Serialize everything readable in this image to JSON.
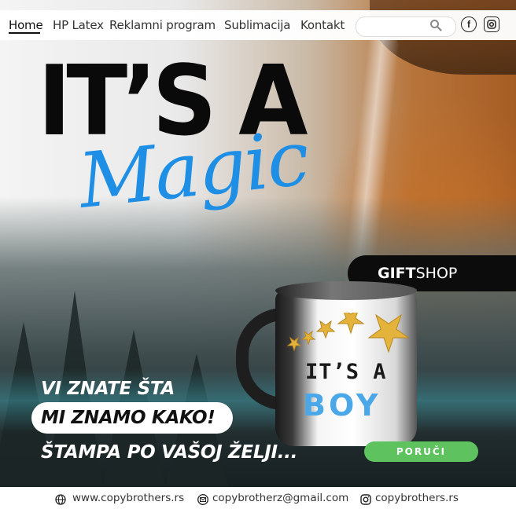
{
  "nav": {
    "items": [
      {
        "label": "Home",
        "active": true
      },
      {
        "label": "HP Latex",
        "active": false
      },
      {
        "label": "Reklamni program",
        "active": false
      },
      {
        "label": "Sublimacija",
        "active": false
      },
      {
        "label": "Kontakt",
        "active": false
      }
    ],
    "search_placeholder": "",
    "social_icons": [
      "facebook-icon",
      "instagram-icon"
    ]
  },
  "hero": {
    "headline": "IT’S A",
    "script_word": "Magic",
    "badge_bold": "GIFT",
    "badge_light": "SHOP",
    "mug_line1": "IT’S A",
    "mug_line2": "BOY",
    "slogan_1": "VI ZNATE ŠTA",
    "slogan_2": "MI ZNAMO KAKO!",
    "slogan_3": "ŠTAMPA PO VAŠOJ ŽELJI...",
    "order_button": "PORUČI"
  },
  "footer": {
    "website": "www.copybrothers.rs",
    "email": "copybrotherz@gmail.com",
    "instagram": "copybrothers.rs"
  },
  "colors": {
    "accent_blue": "#1f8fe6",
    "order_green": "#5ec25e",
    "badge_black": "#0c0c0c"
  }
}
